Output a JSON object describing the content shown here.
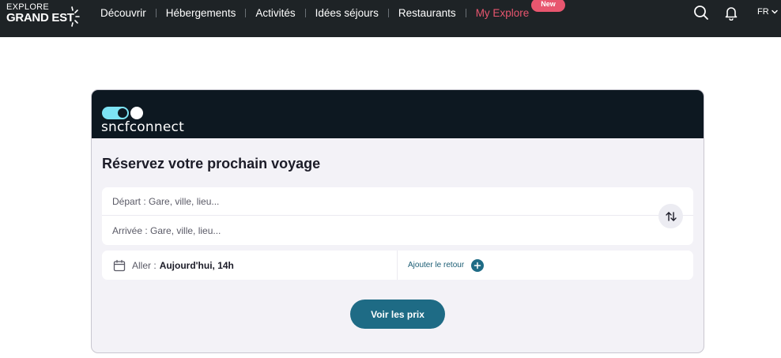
{
  "header": {
    "logo": {
      "line1": "EXPLORE",
      "line2": "GRAND EST"
    },
    "nav": [
      {
        "label": "Découvrir"
      },
      {
        "label": "Hébergements"
      },
      {
        "label": "Activités"
      },
      {
        "label": "Idées séjours"
      },
      {
        "label": "Restaurants"
      },
      {
        "label": "My Explore",
        "badge": "New"
      }
    ],
    "icons": [
      "search-icon",
      "bell-icon",
      "chevron-down-icon"
    ],
    "language": "FR",
    "colors": {
      "background": "#1e2326",
      "accent": "#e8566f"
    }
  },
  "booking": {
    "brand": "sncfconnect",
    "title": "Réservez votre prochain voyage",
    "departure_placeholder": "Départ : Gare, ville, lieu...",
    "arrival_placeholder": "Arrivée : Gare, ville, lieu...",
    "outbound_label": "Aller :",
    "outbound_value": "Aujourd'hui, 14h",
    "return_label": "Ajouter le retour",
    "cta_label": "Voir les prix",
    "colors": {
      "header": "#0d1821",
      "primary": "#1e6b85",
      "toggle": "#7de3f4"
    }
  }
}
